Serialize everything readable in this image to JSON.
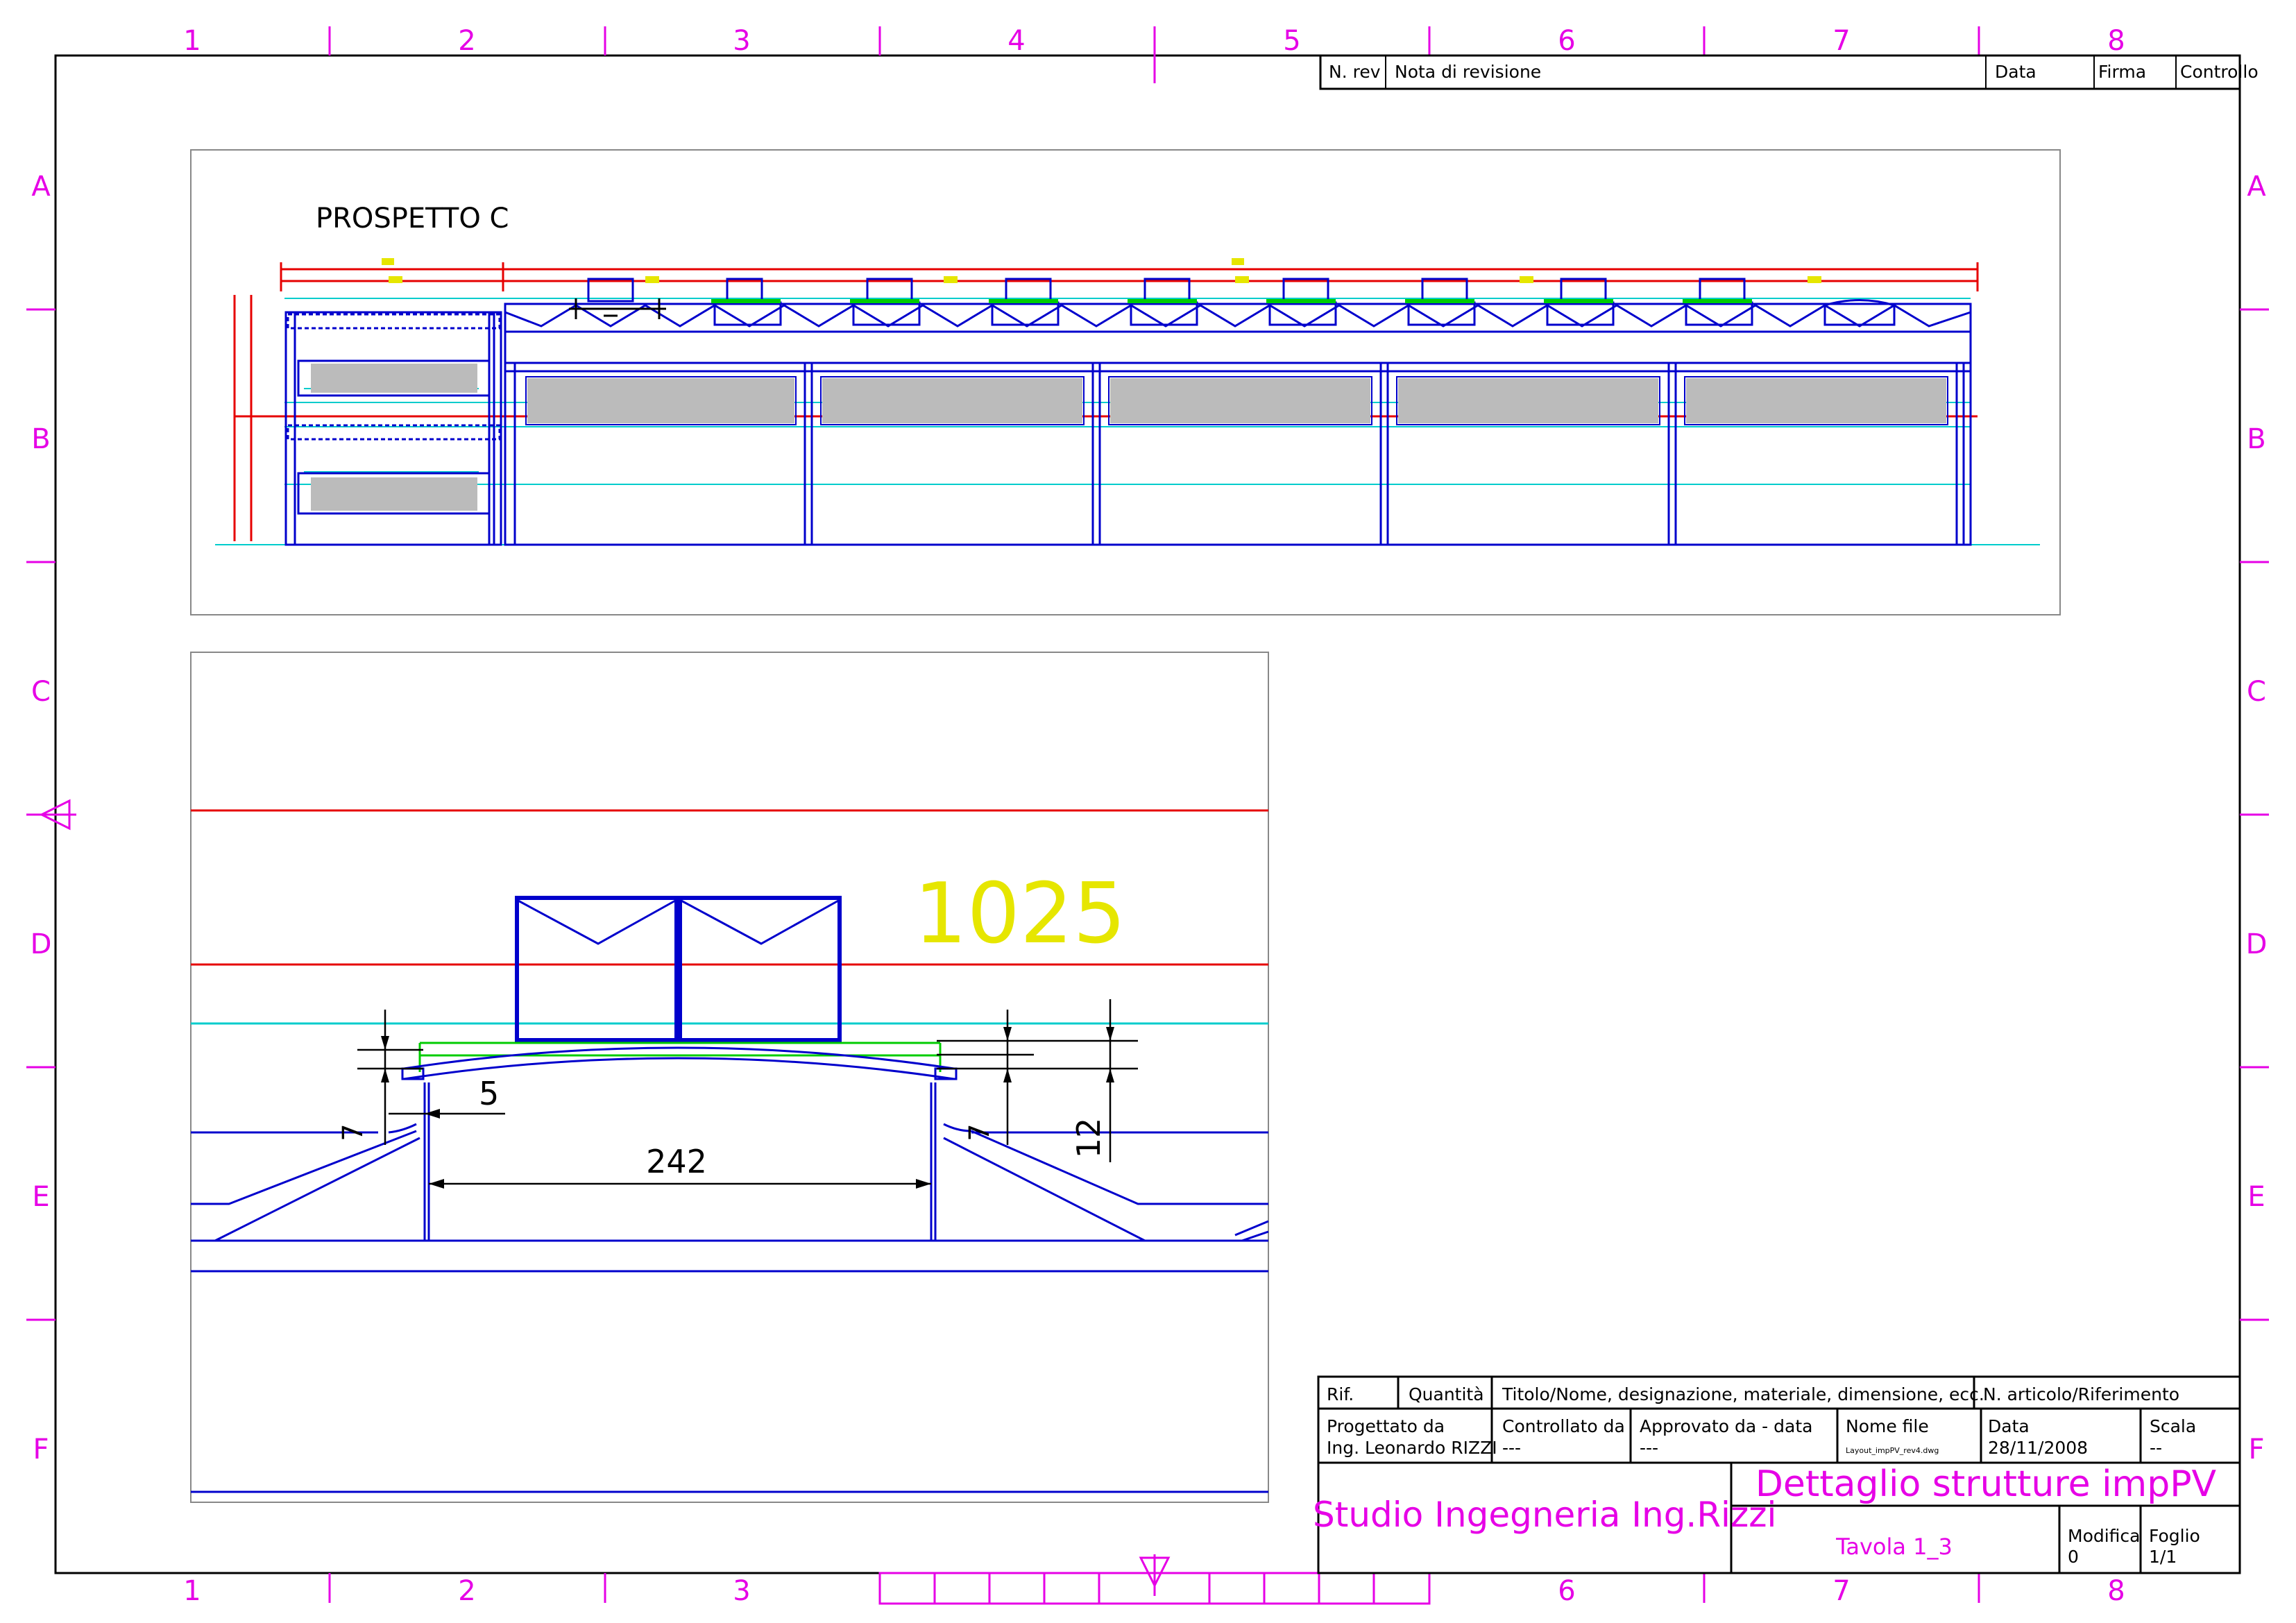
{
  "frame": {
    "columns": [
      "1",
      "2",
      "3",
      "4",
      "5",
      "6",
      "7",
      "8"
    ],
    "rows": [
      "A",
      "B",
      "C",
      "D",
      "E",
      "F"
    ]
  },
  "revision_table": {
    "headers": [
      "N. rev",
      "Nota di revisione",
      "Data",
      "Firma",
      "Controllo"
    ]
  },
  "views": {
    "elevation_title": "PROSPETTO C",
    "detail_label": "1025",
    "dims": {
      "width": "242",
      "gap": "5",
      "height": "12",
      "left_small": "7",
      "right_small": "7"
    }
  },
  "title_block": {
    "row1": [
      "Rif.",
      "Quantità",
      "Titolo/Nome, designazione, materiale, dimensione, ecc.",
      "N. articolo/Riferimento"
    ],
    "designed_by_label": "Progettato da",
    "designed_by": "Ing. Leonardo RIZZI",
    "checked_by_label": "Controllato da",
    "checked_by": "---",
    "approved_label": "Approvato da - data",
    "approved": "---",
    "filename_label": "Nome file",
    "filename": "Layout_impPV_rev4.dwg",
    "date_label": "Data",
    "date": "28/11/2008",
    "scale_label": "Scala",
    "scale": "--",
    "studio": "Studio Ingegneria Ing.Rizzi",
    "title": "Dettaglio strutture impPV",
    "sheet_label": "Tavola 1_3",
    "modifica_label": "Modifica",
    "modifica": "0",
    "foglio_label": "Foglio",
    "foglio": "1/1"
  },
  "colors": {
    "frame": "#e600e6",
    "structure": "#0000cc",
    "guide": "#00cccc",
    "dimension": "#e60000",
    "label": "#e6e600",
    "panel": "#00cc00"
  }
}
